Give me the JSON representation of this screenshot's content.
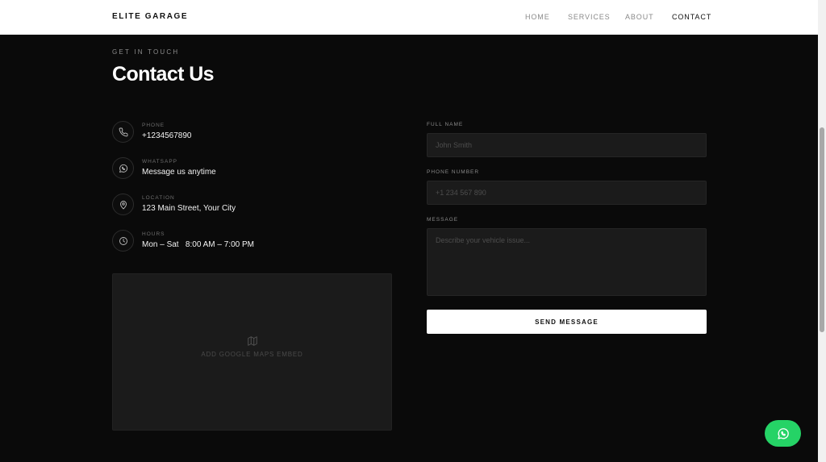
{
  "header": {
    "brand": "ELITE GARAGE",
    "nav": [
      {
        "label": "HOME"
      },
      {
        "label": "SERVICES"
      },
      {
        "label": "ABOUT"
      },
      {
        "label": "CONTACT",
        "active": true
      }
    ]
  },
  "section": {
    "eyebrow": "GET IN TOUCH",
    "title": "Contact Us"
  },
  "contact": {
    "items": [
      {
        "icon": "phone-icon",
        "label": "PHONE",
        "value": "+1234567890"
      },
      {
        "icon": "whatsapp-icon",
        "label": "WHATSAPP",
        "value": "Message us anytime"
      },
      {
        "icon": "location-pin-icon",
        "label": "LOCATION",
        "value": "123 Main Street, Your City"
      },
      {
        "icon": "clock-icon",
        "label": "HOURS",
        "value": "Mon – Sat   8:00 AM – 7:00 PM"
      }
    ]
  },
  "map": {
    "icon": "map-icon",
    "title": "ADD GOOGLE MAPS EMBED"
  },
  "form": {
    "name_label": "FULL NAME",
    "name_placeholder": "John Smith",
    "name_value": "",
    "phone_label": "PHONE NUMBER",
    "phone_placeholder": "+1 234 567 890",
    "phone_value": "",
    "message_label": "MESSAGE",
    "message_placeholder": "Describe your vehicle issue...",
    "message_value": "",
    "submit_label": "SEND MESSAGE"
  },
  "floating": {
    "icon": "whatsapp-icon"
  },
  "colors": {
    "background": "#0a0a0a",
    "header_bg": "#ffffff",
    "field_bg": "#1b1b1b",
    "accent_whatsapp": "#25d366"
  }
}
